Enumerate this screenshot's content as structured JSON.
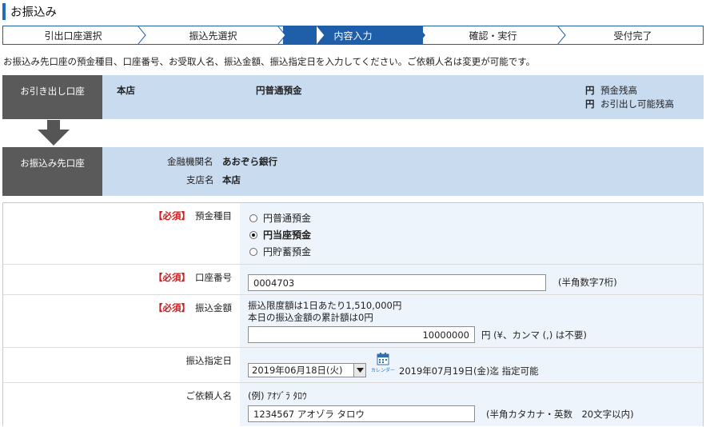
{
  "page": {
    "title": "お振込み"
  },
  "steps": [
    "引出口座選択",
    "振込先選択",
    "内容入力",
    "確認・実行",
    "受付完了"
  ],
  "active_step": 2,
  "intro": "お振込み先口座の預金種目、口座番号、お受取人名、振込金額、振込指定日を入力してください。ご依頼人名は変更が可能です。",
  "source_account": {
    "label": "お引き出し口座",
    "branch": "本店",
    "type": "円普通預金",
    "balance_unit": "円",
    "balance_label": "預金残高",
    "available_unit": "円",
    "available_label": "お引出し可能残高"
  },
  "dest_account": {
    "label": "お振込み先口座",
    "bank_label": "金融機関名",
    "bank_value": "あおぞら銀行",
    "branch_label": "支店名",
    "branch_value": "本店"
  },
  "form": {
    "required_tag": "【必須】",
    "deposit_type": {
      "label": "預金種目",
      "options": [
        "円普通預金",
        "円当座預金",
        "円貯蓄預金"
      ],
      "selected": 1
    },
    "account_number": {
      "label": "口座番号",
      "value": "0004703",
      "hint": "(半角数字7桁)"
    },
    "amount": {
      "label": "振込金額",
      "limit_text": "振込限度額は1日あたり1,510,000円",
      "today_text": "本日の振込金額の累計額は0円",
      "value": "10000000",
      "hint": "円 (¥、カンマ (,) は不要)"
    },
    "date": {
      "label": "振込指定日",
      "selected": "2019年06月18日(火)",
      "calendar_label": "カレンダー",
      "hint": "2019年07月19日(金)迄 指定可能"
    },
    "requester": {
      "label": "ご依頼人名",
      "example": "(例) ｱｵｿﾞﾗ ﾀﾛｳ",
      "value": "1234567 アオゾラ タロウ",
      "hint": "(半角カタカナ・英数　20文字以内)"
    }
  },
  "colors": {
    "accent": "#1f5ea8",
    "panel": "#c9dbef",
    "label_bg": "#5a5a5a",
    "required": "#d01c1c"
  }
}
